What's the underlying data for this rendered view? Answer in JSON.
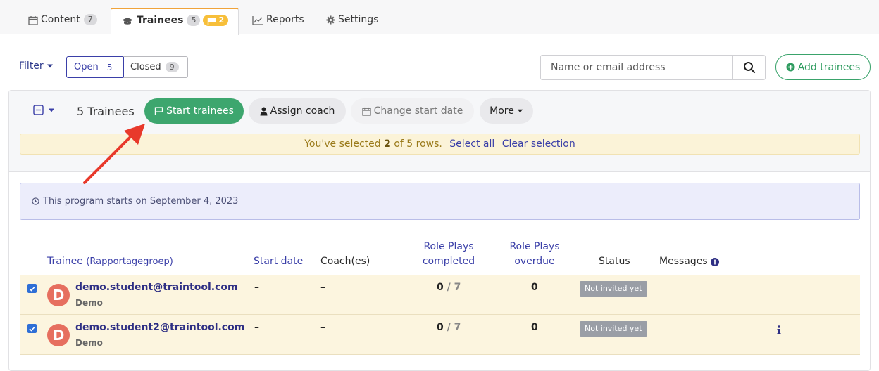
{
  "tabs": [
    {
      "label": "Content",
      "count": "7",
      "icon": "calendar-icon"
    },
    {
      "label": "Trainees",
      "count": "5",
      "flag_count": "2",
      "icon": "graduation-cap-icon",
      "active": true
    },
    {
      "label": "Reports",
      "icon": "line-chart-icon"
    },
    {
      "label": "Settings",
      "icon": "gear-icon"
    }
  ],
  "toolbar": {
    "filter_label": "Filter",
    "open_label": "Open",
    "open_count": "5",
    "closed_label": "Closed",
    "closed_count": "9",
    "search_placeholder": "Name or email address",
    "add_label": "Add trainees"
  },
  "bulk": {
    "count_label": "5 Trainees",
    "start_label": "Start trainees",
    "coach_label": "Assign coach",
    "change_label": "Change start date",
    "more_label": "More"
  },
  "selection": {
    "prefix": "You've selected",
    "selected": "2",
    "suffix": "of 5 rows.",
    "select_all": "Select all",
    "clear": "Clear selection"
  },
  "notice": "This program starts on September 4, 2023",
  "table": {
    "headers": {
      "trainee": "Trainee",
      "trainee_group": "(Rapportagegroep)",
      "start_date": "Start date",
      "coaches": "Coach(es)",
      "rp_completed_1": "Role Plays",
      "rp_completed_2": "completed",
      "rp_overdue_1": "Role Plays",
      "rp_overdue_2": "overdue",
      "status": "Status",
      "messages": "Messages"
    },
    "rows": [
      {
        "avatar": "D",
        "email": "demo.student@traintool.com",
        "group": "Demo",
        "start_date": "–",
        "coach": "–",
        "completed": "0",
        "total": "7",
        "overdue": "0",
        "status": "Not invited yet",
        "checked": true
      },
      {
        "avatar": "D",
        "email": "demo.student2@traintool.com",
        "group": "Demo",
        "start_date": "–",
        "coach": "–",
        "completed": "0",
        "total": "7",
        "overdue": "0",
        "status": "Not invited yet",
        "checked": true
      }
    ]
  },
  "colors": {
    "accent_green": "#3da66e",
    "accent_blue": "#3a3fa8",
    "tab_active_border": "#f0a33a",
    "selection_bg": "#fbf3d8",
    "arrow": "#e8392b"
  }
}
